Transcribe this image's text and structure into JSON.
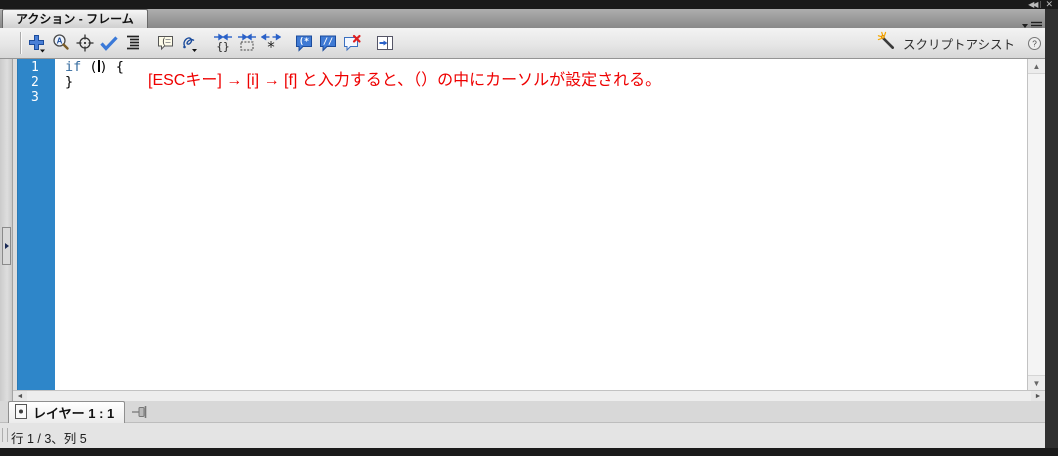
{
  "window": {
    "tab_title": "アクション - フレーム",
    "collapse_glyph": "◀◀",
    "close_glyph": "✕"
  },
  "toolbar": {
    "icons": [
      "add-script-icon",
      "find-icon",
      "insert-target-path-icon",
      "check-syntax-icon",
      "auto-format-icon",
      "show-code-hint-icon",
      "debug-options-icon",
      "collapse-between-braces-icon",
      "collapse-selection-icon",
      "expand-all-icon",
      "apply-block-comment-icon",
      "apply-line-comment-icon",
      "remove-comment-icon",
      "show-hide-toolbox-icon"
    ],
    "script_assist_label": "スクリプトアシスト",
    "help_glyph": "?"
  },
  "editor": {
    "line_numbers": [
      "1",
      "2",
      "3"
    ],
    "code": {
      "line1_keyword": "if",
      "line1_open": " (",
      "line1_close": ") {",
      "line2": "}"
    },
    "annotation": "[ESCキー] → [i] → [f] と入力すると、（）の中にカーソルが設定される。"
  },
  "script_nav": {
    "tab_label": "レイヤー 1 : 1"
  },
  "status_bar": {
    "text": "行 1 / 3、列 5"
  },
  "colors": {
    "gutter_blue": "#2E86C9",
    "keyword_blue": "#336A9E",
    "annotation_red": "#EE0000",
    "icon_blue": "#2A61C8",
    "frame_dark": "#1A1A1A"
  }
}
